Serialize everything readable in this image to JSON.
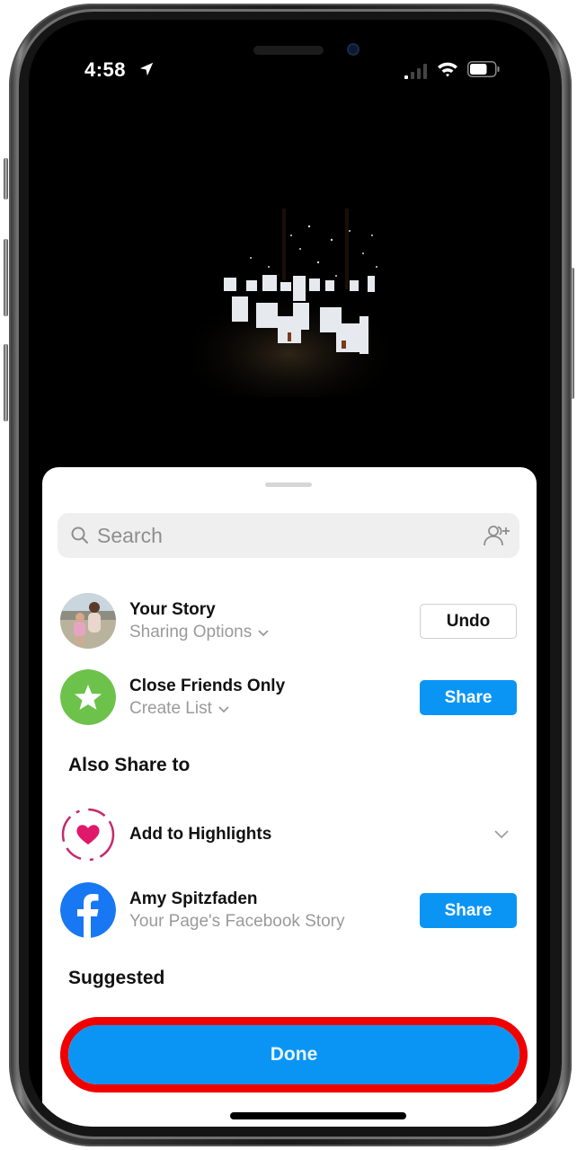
{
  "status_bar": {
    "time": "4:58",
    "location_active": true,
    "signal_bars_active": 1,
    "signal_bars_total": 4,
    "wifi": "connected",
    "battery_percent": 65
  },
  "media": {
    "description": "Night photo of illuminated paper lantern houses"
  },
  "sheet": {
    "search": {
      "placeholder": "Search",
      "value": ""
    },
    "story_rows": [
      {
        "title": "Your Story",
        "subtitle": "Sharing Options",
        "button_label": "Undo",
        "button_style": "outline",
        "avatar": "user-photo"
      },
      {
        "title": "Close Friends Only",
        "subtitle": "Create List",
        "button_label": "Share",
        "button_style": "primary",
        "avatar": "star-icon"
      }
    ],
    "also_share_to": {
      "heading": "Also Share to",
      "items": [
        {
          "title": "Add to Highlights",
          "icon": "highlight-heart-icon"
        },
        {
          "title": "Amy Spitzfaden",
          "subtitle": "Your Page's Facebook Story",
          "button_label": "Share",
          "icon": "facebook-icon"
        }
      ]
    },
    "suggested_heading": "Suggested",
    "done_label": "Done"
  },
  "colors": {
    "primary_blue": "#0a95f4",
    "close_friends_green": "#6cc24a",
    "highlight_pink": "#d6246e",
    "facebook_blue": "#1877f2",
    "annotation_red": "#f10000"
  }
}
